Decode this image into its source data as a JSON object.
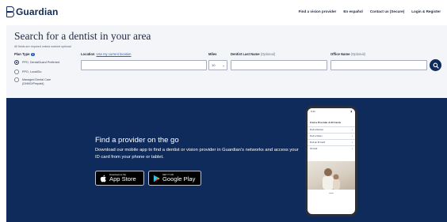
{
  "header": {
    "logo_text": "Guardian",
    "nav": [
      "Find a vision provider",
      "En español",
      "Contact us (Secure)",
      "Login & Register"
    ]
  },
  "search": {
    "title": "Search for a dentist in your area",
    "required_note": "All fields are required unless marked optional",
    "plan_type_label": "Plan Type",
    "plans": [
      {
        "label": "PPO, DentalGuard Preferred",
        "selected": true
      },
      {
        "label": "PPO, LocalGlo",
        "selected": false
      },
      {
        "label": "Managed Dental Care (DHMO/Prepaid)",
        "selected": false
      }
    ],
    "location_label": "Location",
    "location_link": "Use my current location",
    "location_value": "",
    "miles_label": "Miles",
    "miles_value": "10",
    "dentist_label": "Dentist Last Name",
    "dentist_optional": "(Optional)",
    "dentist_value": "",
    "office_label": "Office Name",
    "office_optional": "(Optional)",
    "office_value": ""
  },
  "promo": {
    "title": "Find a provider on the go",
    "description": "Download our mobile app to find a dentist or vision provider in Guardian's networks and access your ID card from your phone or tablet.",
    "app_store": {
      "small": "Download on the",
      "big": "App Store"
    },
    "google_play": {
      "small": "GET IT ON",
      "big": "Google Play"
    }
  },
  "phone": {
    "time": "9:41",
    "heading": "Find a Provider & ID Cards",
    "items": [
      "Find a Dentist",
      "Find a Vision",
      "Find an ID Card",
      "ID Card"
    ]
  },
  "colors": {
    "brand_navy": "#0f2b5b",
    "panel_gray": "#f4f5f8",
    "link_blue": "#2a63c6"
  }
}
